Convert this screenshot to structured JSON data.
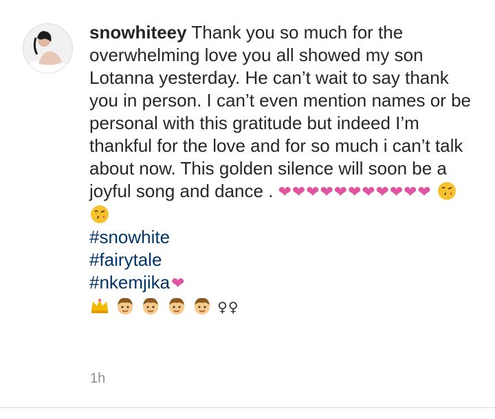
{
  "post": {
    "username": "snowhiteey",
    "caption_text": "Thank you so much for the overwhelming love you all showed my son Lotanna yesterday. He can’t wait to say thank you in person. I can’t even mention names or be personal with this gratitude but indeed I’m thankful for the love and for so much i can’t talk about now. This golden silence will soon be a joyful song and dance .",
    "hearts": "❤❤❤❤❤❤❤❤❤❤❤",
    "hashtags": [
      "#snowhite",
      "#fairytale",
      "#nkemjika"
    ],
    "tag_heart": "❤",
    "emoji_symbols": "♀♀",
    "timestamp": "1h",
    "icons": {
      "avatar": "profile-photo",
      "kiss": "face-blowing-kiss-icon",
      "crown": "crown-icon",
      "boy": "boy-face-icon"
    },
    "colors": {
      "text": "#262626",
      "hashtag": "#003569",
      "heart": "#e0559f",
      "timestamp": "#8e8e8e"
    }
  }
}
